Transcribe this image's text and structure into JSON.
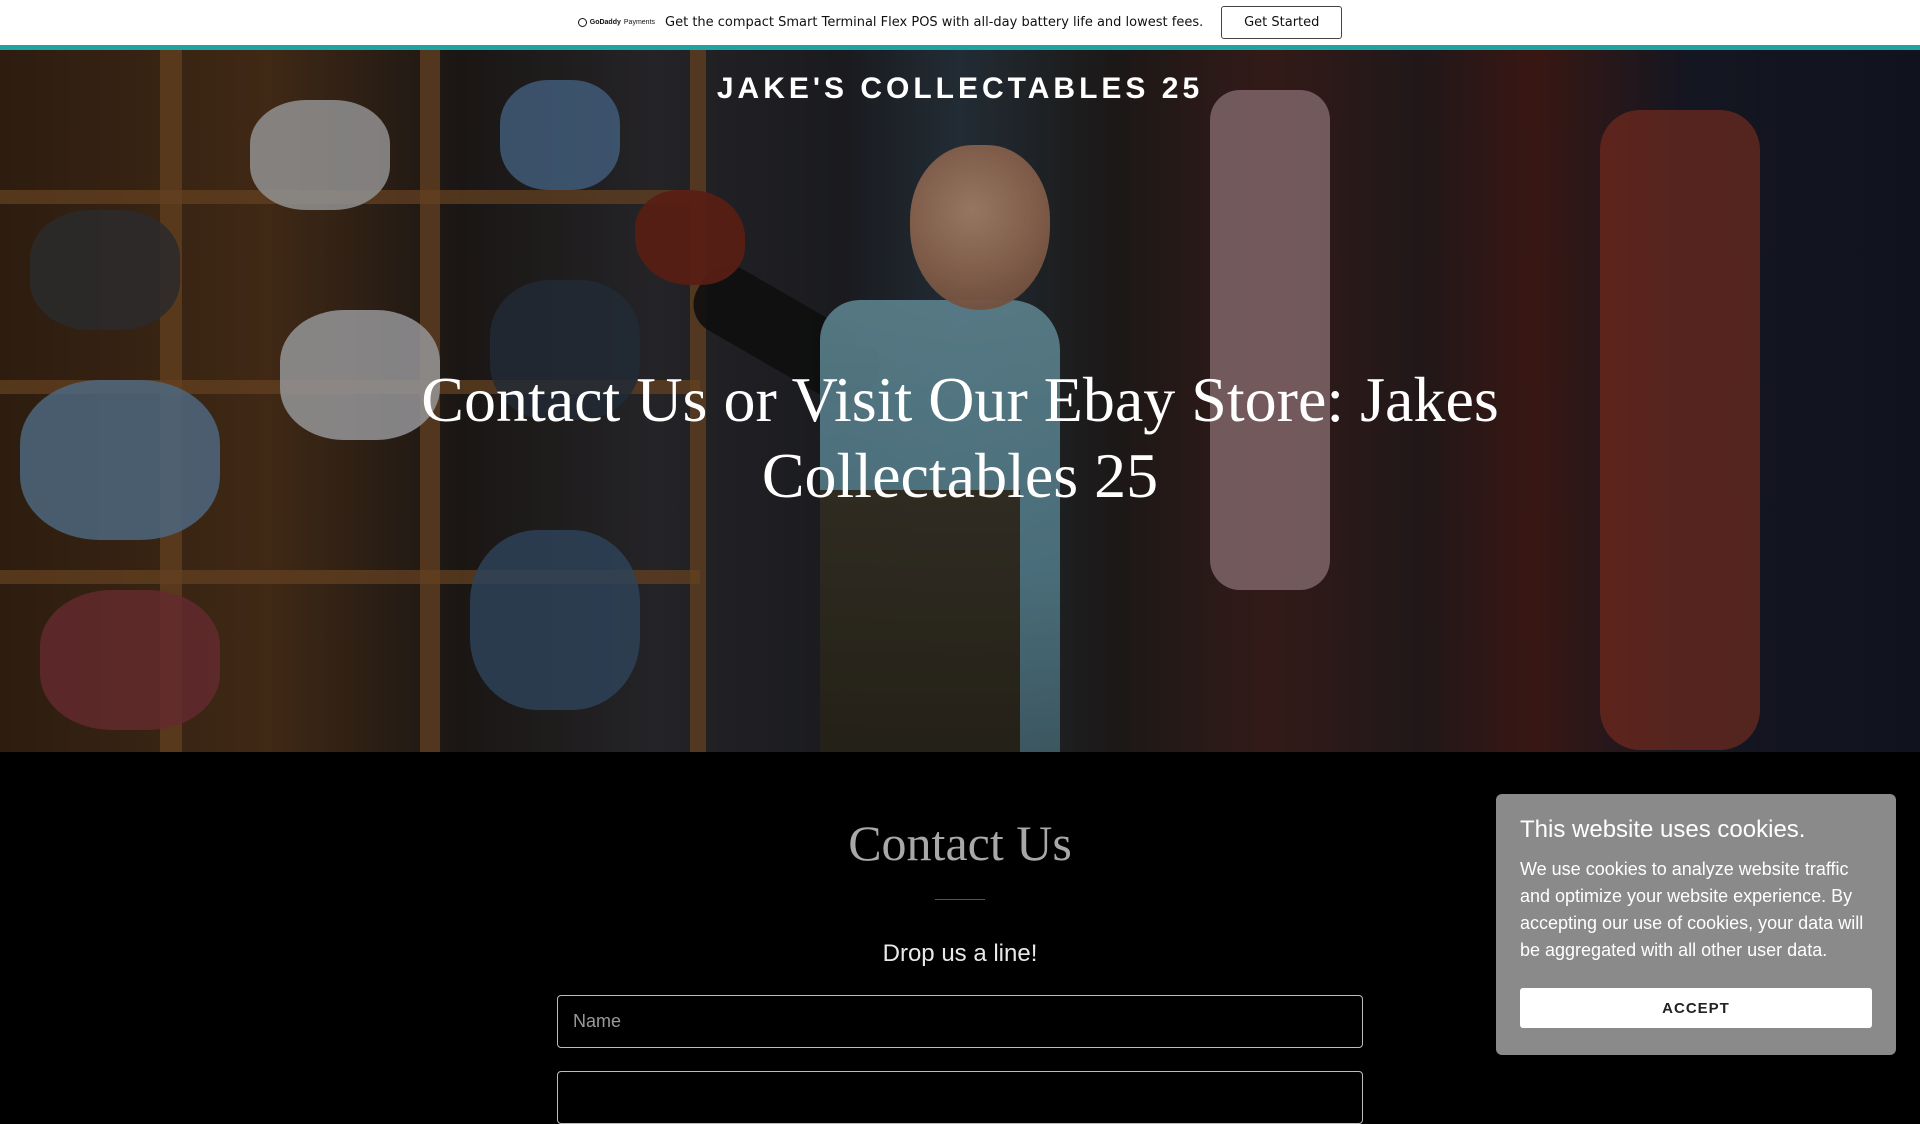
{
  "promo": {
    "logo_bold": "GoDaddy",
    "logo_light": "Payments",
    "text": "Get the compact Smart Terminal Flex POS with all-day battery life and lowest fees.",
    "button_label": "Get Started"
  },
  "colors": {
    "accent": "#1fa3a3",
    "background": "#000000",
    "cookie_bg": "#8a8a8a"
  },
  "hero": {
    "site_title": "JAKE'S COLLECTABLES 25",
    "heading": "Contact Us or Visit Our Ebay Store: Jakes Collectables 25"
  },
  "contact": {
    "title": "Contact Us",
    "subtitle": "Drop us a line!",
    "name_placeholder": "Name"
  },
  "cookie": {
    "title": "This website uses cookies.",
    "body": "We use cookies to analyze website traffic and optimize your website experience. By accepting our use of cookies, your data will be aggregated with all other user data.",
    "accept_label": "ACCEPT"
  }
}
